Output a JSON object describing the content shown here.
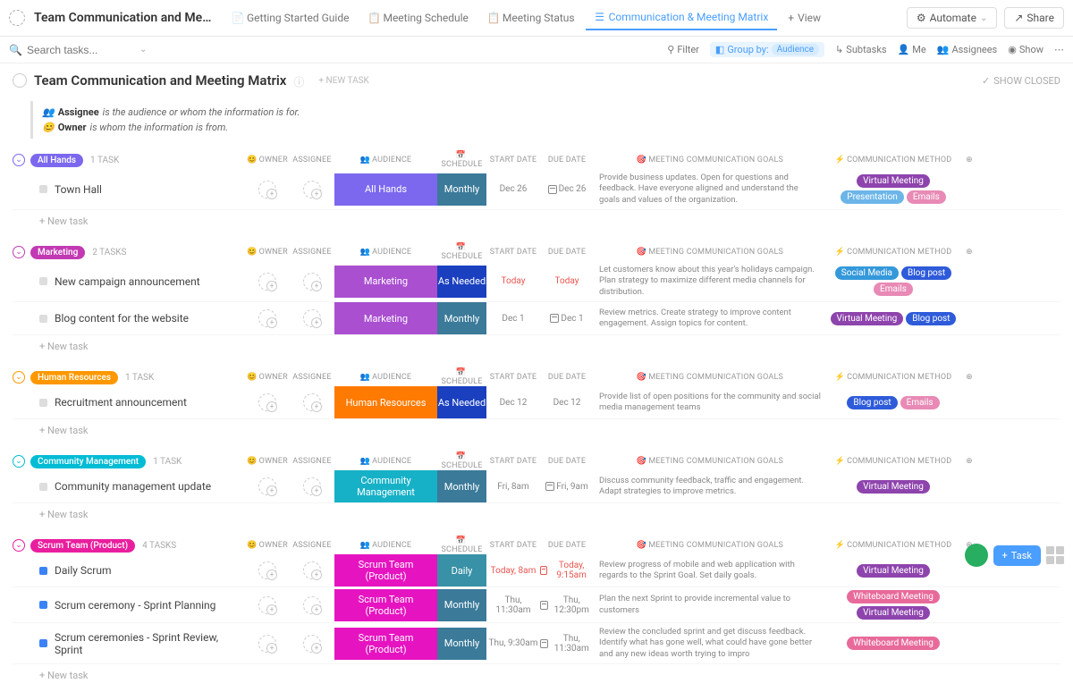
{
  "header": {
    "title": "Team Communication and Meeting Ma...",
    "tabs": [
      {
        "label": "Getting Started Guide"
      },
      {
        "label": "Meeting Schedule"
      },
      {
        "label": "Meeting Status"
      },
      {
        "label": "Communication & Meeting Matrix",
        "active": true
      }
    ],
    "view_btn": "View",
    "automate": "Automate",
    "share": "Share"
  },
  "toolbar": {
    "search_placeholder": "Search tasks...",
    "filter": "Filter",
    "group_by": "Group by:",
    "group_by_value": "Audience",
    "subtasks": "Subtasks",
    "me": "Me",
    "assignees": "Assignees",
    "show": "Show"
  },
  "page": {
    "title": "Team Communication and Meeting Matrix",
    "new_task": "+ NEW TASK",
    "show_closed": "SHOW CLOSED"
  },
  "legend": {
    "assignee_label": "Assignee",
    "assignee_text": "is the audience or whom the information is for.",
    "owner_label": "Owner",
    "owner_text": "is whom the information is from."
  },
  "columns": {
    "owner": "OWNER",
    "assignee": "ASSIGNEE",
    "audience": "AUDIENCE",
    "schedule": "SCHEDULE",
    "start_date": "START DATE",
    "due_date": "DUE DATE",
    "goals": "MEETING COMMUNICATION GOALS",
    "method": "COMMUNICATION METHOD"
  },
  "new_task_row": "+ New task",
  "groups": [
    {
      "name": "All Hands",
      "count": "1 TASK",
      "pill_color": "#7b68ee",
      "toggle_color": "#7b68ee",
      "rows": [
        {
          "task": "Town Hall",
          "status": "grey",
          "audience": "All Hands",
          "aud_color": "#7b68ee",
          "schedule": "Monthly",
          "sched_color": "#3b7a99",
          "start": "Dec 26",
          "start_red": false,
          "due": "Dec 26",
          "due_red": false,
          "due_cal": true,
          "goals": "Provide business updates. Open for questions and feedback. Have everyone aligned and understand the goals and values of the organization.",
          "methods": [
            {
              "text": "Virtual Meeting",
              "color": "#8e44ad"
            },
            {
              "text": "Presentation",
              "color": "#6bb5e8"
            },
            {
              "text": "Emails",
              "color": "#e88ab5"
            }
          ]
        }
      ]
    },
    {
      "name": "Marketing",
      "count": "2 TASKS",
      "pill_color": "#c239b3",
      "toggle_color": "#c239b3",
      "rows": [
        {
          "task": "New campaign announcement",
          "status": "grey",
          "audience": "Marketing",
          "aud_color": "#a94fd0",
          "schedule": "As Needed",
          "sched_color": "#1a3fbf",
          "start": "Today",
          "start_red": true,
          "due": "Today",
          "due_red": true,
          "goals": "Let customers know about this year's holidays campaign. Plan strategy to maximize different media channels for distribution.",
          "methods": [
            {
              "text": "Social Media",
              "color": "#3498db"
            },
            {
              "text": "Blog post",
              "color": "#2e5bd9"
            },
            {
              "text": "Emails",
              "color": "#e88ab5"
            }
          ]
        },
        {
          "task": "Blog content for the website",
          "status": "grey",
          "audience": "Marketing",
          "aud_color": "#a94fd0",
          "schedule": "Monthly",
          "sched_color": "#3b7a99",
          "start": "Dec 1",
          "start_red": false,
          "due": "Dec 1",
          "due_red": false,
          "due_cal": true,
          "goals": "Review metrics. Create strategy to improve content engagement. Assign topics for content.",
          "methods": [
            {
              "text": "Virtual Meeting",
              "color": "#8e44ad"
            },
            {
              "text": "Blog post",
              "color": "#2e5bd9"
            }
          ]
        }
      ]
    },
    {
      "name": "Human Resources",
      "count": "1 TASK",
      "pill_color": "#ff9800",
      "toggle_color": "#ff9800",
      "rows": [
        {
          "task": "Recruitment announcement",
          "status": "grey",
          "audience": "Human Resources",
          "aud_color": "#ff7a00",
          "schedule": "As Needed",
          "sched_color": "#1a3fbf",
          "start": "Dec 12",
          "start_red": false,
          "due": "Dec 12",
          "due_red": false,
          "goals": "Provide list of open positions for the community and social media management teams",
          "methods": [
            {
              "text": "Blog post",
              "color": "#2e5bd9"
            },
            {
              "text": "Emails",
              "color": "#e88ab5"
            }
          ]
        }
      ]
    },
    {
      "name": "Community Management",
      "count": "1 TASK",
      "pill_color": "#00bcd4",
      "toggle_color": "#00bcd4",
      "rows": [
        {
          "task": "Community management update",
          "status": "grey",
          "audience": "Community Management",
          "aud_color": "#17b1c7",
          "schedule": "Monthly",
          "sched_color": "#3b7a99",
          "start": "Fri, 8am",
          "start_red": false,
          "due": "Fri, 9am",
          "due_red": false,
          "due_cal": true,
          "goals": "Discuss community feedback, traffic and engagement. Adapt strategies to improve metrics.",
          "methods": [
            {
              "text": "Virtual Meeting",
              "color": "#8e44ad"
            }
          ]
        }
      ]
    },
    {
      "name": "Scrum Team (Product)",
      "count": "4 TASKS",
      "pill_color": "#e91e9e",
      "toggle_color": "#e91e9e",
      "rows": [
        {
          "task": "Daily Scrum",
          "status": "blue",
          "audience": "Scrum Team (Product)",
          "aud_color": "#e614c0",
          "schedule": "Daily",
          "sched_color": "#3891a6",
          "start": "Today, 8am",
          "start_red": true,
          "due": "Today, 9:15am",
          "due_red": true,
          "due_cal": true,
          "goals": "Review progress of mobile and web application with regards to the Sprint Goal. Set daily goals.",
          "methods": [
            {
              "text": "Virtual Meeting",
              "color": "#8e44ad"
            }
          ]
        },
        {
          "task": "Scrum ceremony - Sprint Planning",
          "status": "blue",
          "audience": "Scrum Team (Product)",
          "aud_color": "#e614c0",
          "schedule": "Monthly",
          "sched_color": "#3b7a99",
          "start": "Thu, 11:30am",
          "start_red": false,
          "due": "Thu, 12:30pm",
          "due_red": false,
          "due_cal": true,
          "goals": "Plan the next Sprint to provide incremental value to customers",
          "methods": [
            {
              "text": "Whiteboard Meeting",
              "color": "#e86a9a"
            },
            {
              "text": "Virtual Meeting",
              "color": "#8e44ad"
            }
          ]
        },
        {
          "task": "Scrum ceremonies - Sprint Review, Sprint",
          "status": "blue",
          "audience": "Scrum Team (Product)",
          "aud_color": "#e614c0",
          "schedule": "Monthly",
          "sched_color": "#3b7a99",
          "start": "Thu, 9:30am",
          "start_red": false,
          "due": "Thu, 11:30am",
          "due_red": false,
          "due_cal": true,
          "goals": "Review the concluded sprint and get discuss feedback. Identify what has gone well, what could have gone better and any new ideas worth trying to impro",
          "methods": [
            {
              "text": "Whiteboard Meeting",
              "color": "#e86a9a"
            }
          ]
        }
      ]
    }
  ],
  "fab": {
    "task": "Task"
  }
}
